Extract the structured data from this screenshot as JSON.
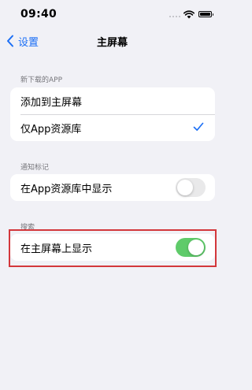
{
  "status_bar": {
    "time": "09:40"
  },
  "nav": {
    "back_label": "设置",
    "title": "主屏幕"
  },
  "sections": [
    {
      "header": "新下载的APP",
      "rows": [
        {
          "label": "添加到主屏幕",
          "checked": false
        },
        {
          "label": "仅App资源库",
          "checked": true
        }
      ]
    },
    {
      "header": "通知标记",
      "rows": [
        {
          "label": "在App资源库中显示",
          "toggle": "off"
        }
      ]
    },
    {
      "header": "搜索",
      "rows": [
        {
          "label": "在主屏幕上显示",
          "toggle": "on"
        }
      ]
    }
  ],
  "colors": {
    "accent": "#1a6ef5",
    "toggle_on": "#5fcb6a",
    "highlight": "#d3373b",
    "background": "#f1f1f6"
  }
}
